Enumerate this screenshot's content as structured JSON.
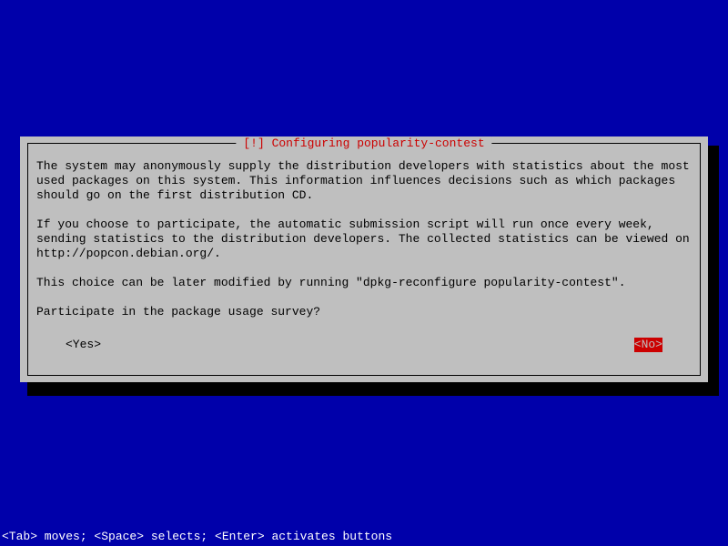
{
  "dialog": {
    "title": " [!] Configuring popularity-contest ",
    "para1": "The system may anonymously supply the distribution developers with statistics about the most used packages on this system. This information influences decisions such as which packages should go on the first distribution CD.",
    "para2": "If you choose to participate, the automatic submission script will run once every week, sending statistics to the distribution developers. The collected statistics can be viewed on http://popcon.debian.org/.",
    "para3": "This choice can be later modified by running \"dpkg-reconfigure popularity-contest\".",
    "prompt": "Participate in the package usage survey?",
    "yes_label": "<Yes>",
    "no_label": "<No>"
  },
  "statusbar": {
    "text": "<Tab> moves; <Space> selects; <Enter> activates buttons"
  }
}
